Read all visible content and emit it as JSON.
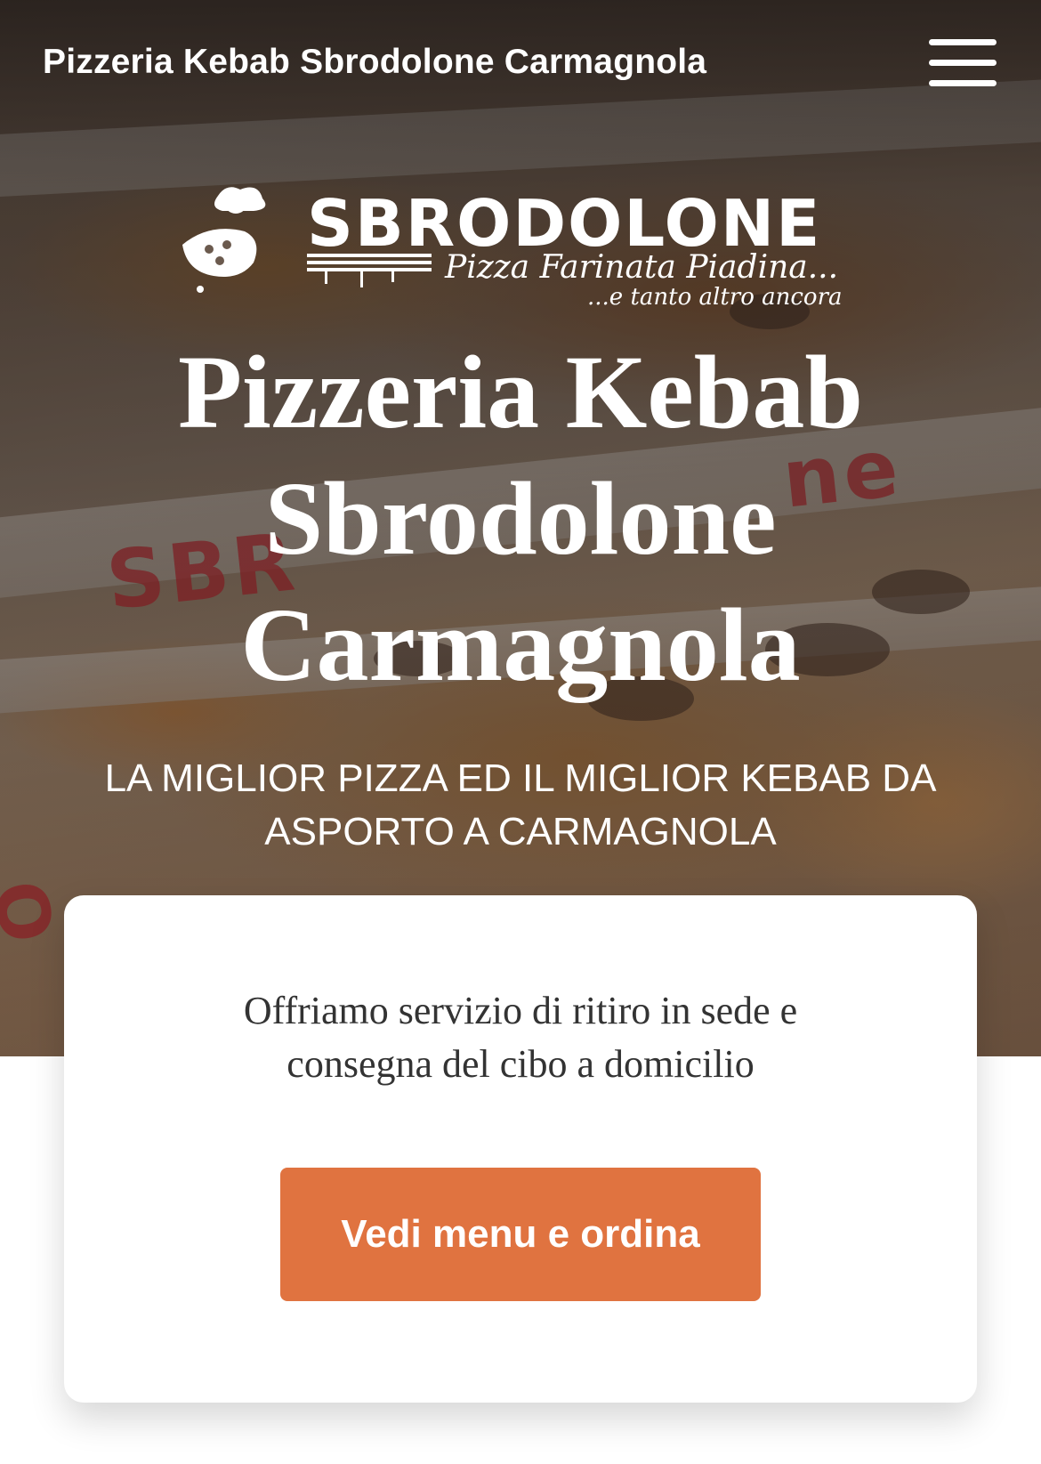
{
  "header": {
    "site_title": "Pizzeria Kebab Sbrodolone Carmagnola",
    "menu_icon": "hamburger-menu-icon"
  },
  "logo": {
    "wordmark": "SBRODOLONE",
    "tagline": "Pizza Farinata Piadina...",
    "tagline_secondary": "...e tanto altro ancora"
  },
  "hero": {
    "title": "Pizzeria Kebab Sbrodolone Carmagnola",
    "subtitle": "LA MIGLIOR PIZZA ED IL MIGLIOR KEBAB DA ASPORTO A CARMAGNOLA"
  },
  "card": {
    "text": "Offriamo servizio di ritiro in sede e consegna del cibo a domicilio",
    "button_label": "Vedi menu e ordina"
  },
  "colors": {
    "accent": "#e07340",
    "card_text": "#333333",
    "hero_text": "#ffffff"
  }
}
